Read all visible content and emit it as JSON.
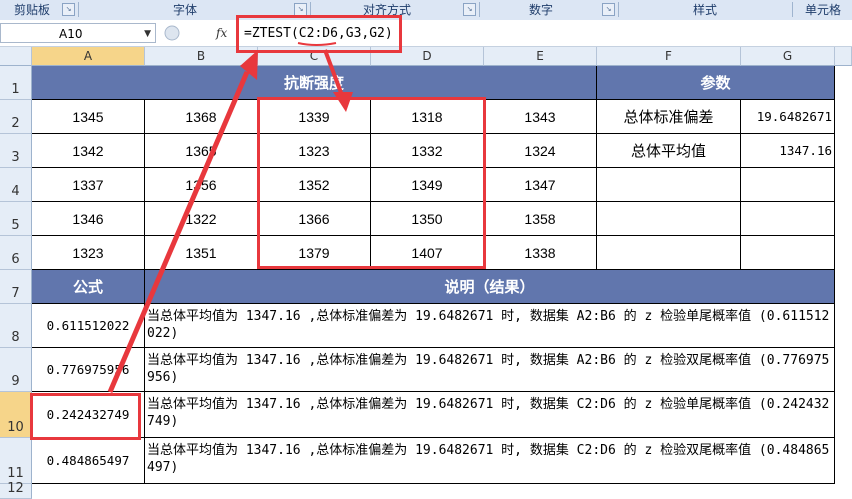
{
  "ribbon": {
    "groups": [
      "剪贴板",
      "字体",
      "对齐方式",
      "数字",
      "样式",
      "单元格"
    ]
  },
  "formula_bar": {
    "name_box": "A10",
    "fx_label": "fx",
    "formula": "=ZTEST(C2:D6,G3,G2)"
  },
  "columns": [
    "A",
    "B",
    "C",
    "D",
    "E",
    "F",
    "G"
  ],
  "rows": [
    "1",
    "2",
    "3",
    "4",
    "5",
    "6",
    "7",
    "8",
    "9",
    "10",
    "11",
    "12"
  ],
  "sheet": {
    "strength_header": "抗断强度",
    "param_header": "参数",
    "data": [
      [
        "1345",
        "1368",
        "1339",
        "1318",
        "1343"
      ],
      [
        "1342",
        "1365",
        "1323",
        "1332",
        "1324"
      ],
      [
        "1337",
        "1356",
        "1352",
        "1349",
        "1347"
      ],
      [
        "1346",
        "1322",
        "1366",
        "1350",
        "1358"
      ],
      [
        "1323",
        "1351",
        "1379",
        "1407",
        "1338"
      ]
    ],
    "params": [
      {
        "label": "总体标准偏差",
        "value": "19.6482671"
      },
      {
        "label": "总体平均值",
        "value": "1347.16"
      }
    ],
    "formula_header": "公式",
    "desc_header": "说明（结果）",
    "results": [
      {
        "value": "0.611512022",
        "desc": "当总体平均值为 1347.16 ,总体标准偏差为 19.6482671 时, 数据集 A2:B6 的 z 检验单尾概率值 (0.611512022)"
      },
      {
        "value": "0.776975956",
        "desc": "当总体平均值为 1347.16 ,总体标准偏差为 19.6482671 时, 数据集 A2:B6 的 z 检验双尾概率值 (0.776975956)"
      },
      {
        "value": "0.242432749",
        "desc": "当总体平均值为 1347.16 ,总体标准偏差为 19.6482671 时, 数据集 C2:D6 的 z 检验单尾概率值 (0.242432749)"
      },
      {
        "value": "0.484865497",
        "desc": "当总体平均值为 1347.16 ,总体标准偏差为 19.6482671 时, 数据集 C2:D6 的 z 检验双尾概率值 (0.484865497)"
      }
    ]
  },
  "colors": {
    "header_fill": "#6176ad",
    "annotation_red": "#e8383d"
  }
}
